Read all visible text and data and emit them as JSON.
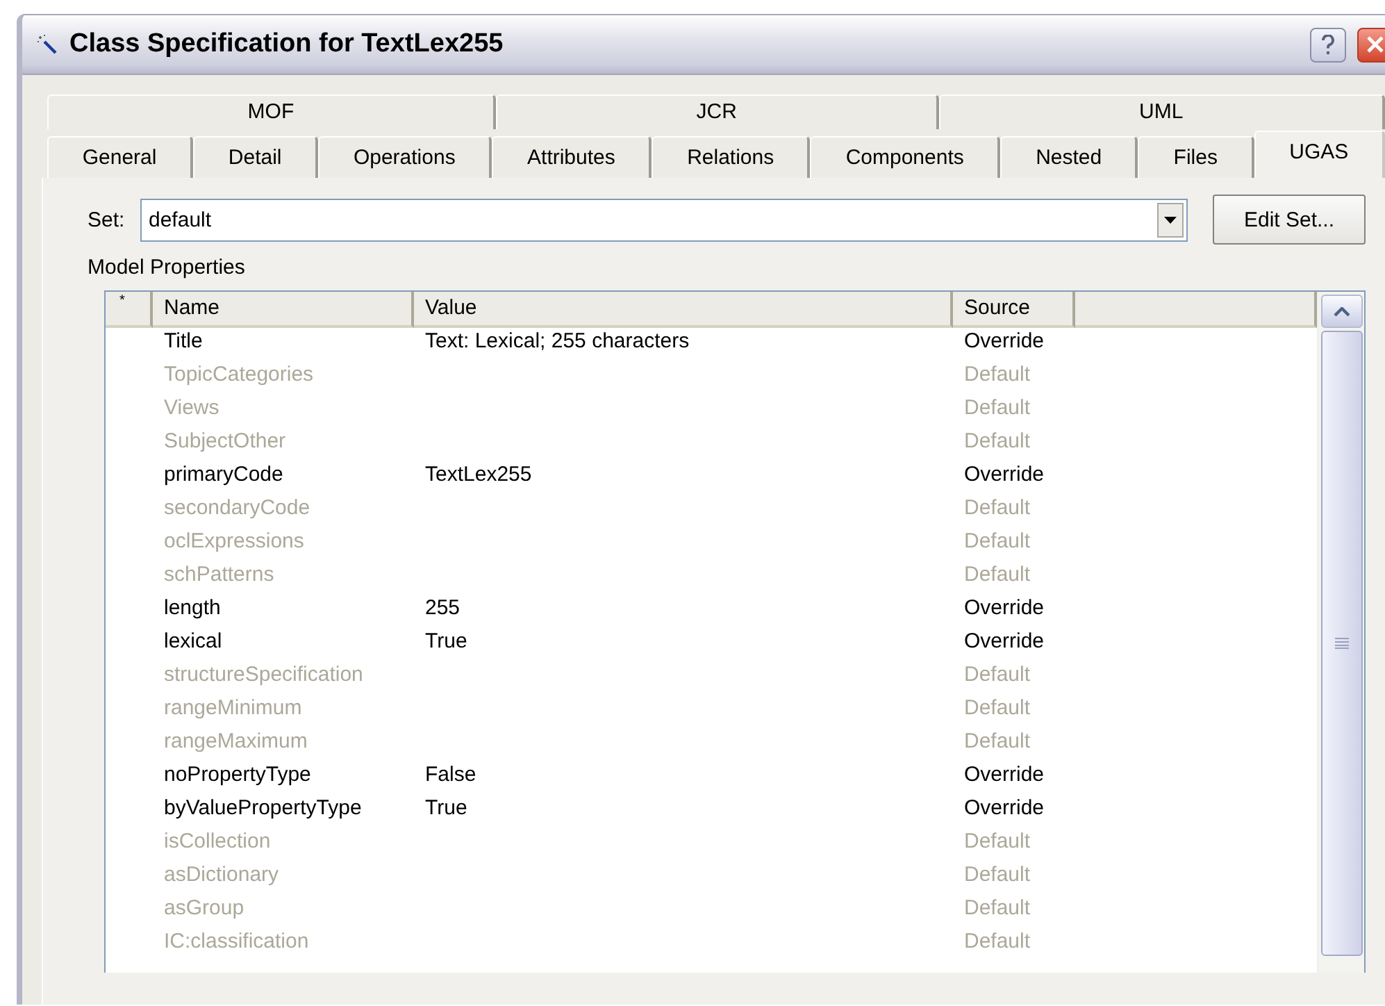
{
  "window": {
    "title": "Class Specification for TextLex255"
  },
  "tabs": {
    "upper": [
      {
        "label": "MOF",
        "selected": false
      },
      {
        "label": "JCR",
        "selected": false
      },
      {
        "label": "UML",
        "selected": false
      }
    ],
    "lower": [
      {
        "label": "General",
        "selected": false
      },
      {
        "label": "Detail",
        "selected": false
      },
      {
        "label": "Operations",
        "selected": false
      },
      {
        "label": "Attributes",
        "selected": false
      },
      {
        "label": "Relations",
        "selected": false
      },
      {
        "label": "Components",
        "selected": false
      },
      {
        "label": "Nested",
        "selected": false
      },
      {
        "label": "Files",
        "selected": false
      },
      {
        "label": "UGAS",
        "selected": true
      }
    ]
  },
  "set": {
    "label": "Set:",
    "value": "default",
    "button": {
      "label": "Edit Set..."
    }
  },
  "properties": {
    "label": "Model Properties",
    "columns": [
      "*",
      "Name",
      "Value",
      "Source"
    ],
    "rows": [
      {
        "name": "Title",
        "value": "Text: Lexical; 255 characters",
        "source": "Override",
        "greyed": false
      },
      {
        "name": "TopicCategories",
        "source": "Default",
        "greyed": true
      },
      {
        "name": "Views",
        "source": "Default",
        "greyed": true
      },
      {
        "name": "SubjectOther",
        "source": "Default",
        "greyed": true
      },
      {
        "name": "primaryCode",
        "value": "TextLex255",
        "source": "Override",
        "greyed": false
      },
      {
        "name": "secondaryCode",
        "source": "Default",
        "greyed": true
      },
      {
        "name": "oclExpressions",
        "source": "Default",
        "greyed": true
      },
      {
        "name": "schPatterns",
        "source": "Default",
        "greyed": true
      },
      {
        "name": "length",
        "value": "255",
        "source": "Override",
        "greyed": false
      },
      {
        "name": "lexical",
        "value": "True",
        "source": "Override",
        "greyed": false
      },
      {
        "name": "structureSpecification",
        "source": "Default",
        "greyed": true
      },
      {
        "name": "rangeMinimum",
        "source": "Default",
        "greyed": true
      },
      {
        "name": "rangeMaximum",
        "source": "Default",
        "greyed": true
      },
      {
        "name": "noPropertyType",
        "value": "False",
        "source": "Override",
        "greyed": false
      },
      {
        "name": "byValuePropertyType",
        "value": "True",
        "source": "Override",
        "greyed": false
      },
      {
        "name": "isCollection",
        "source": "Default",
        "greyed": true
      },
      {
        "name": "asDictionary",
        "source": "Default",
        "greyed": true
      },
      {
        "name": "asGroup",
        "source": "Default",
        "greyed": true
      },
      {
        "name": "IC:classification",
        "source": "Default",
        "greyed": true
      }
    ]
  }
}
